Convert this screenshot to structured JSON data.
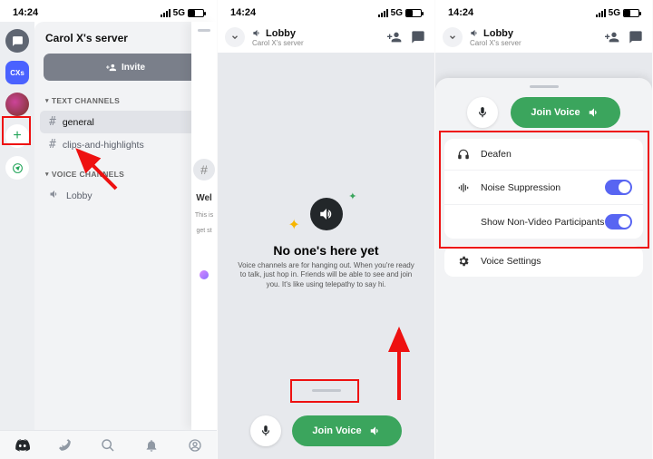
{
  "status": {
    "time": "14:24",
    "network": "5G"
  },
  "phone1": {
    "rail": {
      "cx_label": "CXs"
    },
    "server_name": "Carol X's server",
    "invite_label": "Invite",
    "sections": {
      "text_label": "TEXT CHANNELS",
      "voice_label": "VOICE CHANNELS"
    },
    "channels": {
      "general": "general",
      "clips": "clips-and-highlights",
      "lobby": "Lobby"
    },
    "peek": {
      "welcome": "Wel",
      "sub": "This is",
      "sub2": "get st"
    }
  },
  "lobby": {
    "title": "Lobby",
    "subtitle": "Carol X's server"
  },
  "phone2": {
    "empty_title": "No one's here yet",
    "empty_sub": "Voice channels are for hanging out. When you're ready to talk, just hop in. Friends will be able to see and join you. It's like using telepathy to say hi.",
    "join_label": "Join Voice"
  },
  "phone3": {
    "join_label": "Join Voice",
    "menu": {
      "deafen": "Deafen",
      "noise": "Noise Suppression",
      "nonvideo": "Show Non-Video Participants",
      "voice_settings": "Voice Settings"
    },
    "toggles": {
      "noise": true,
      "nonvideo": true
    }
  }
}
